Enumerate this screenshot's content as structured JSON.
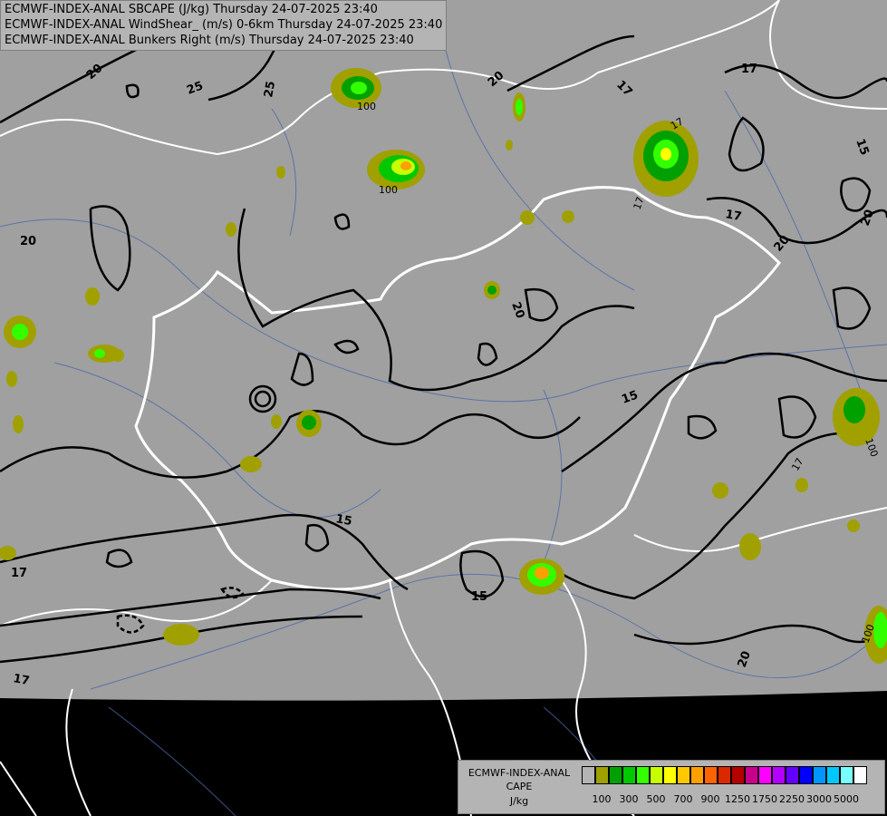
{
  "header": {
    "lines": [
      "ECMWF-INDEX-ANAL SBCAPE (J/kg) Thursday 24-07-2025 23:40",
      "ECMWF-INDEX-ANAL WindShear_ (m/s) 0-6km Thursday 24-07-2025 23:40",
      "ECMWF-INDEX-ANAL Bunkers Right (m/s) Thursday 24-07-2025 23:40"
    ]
  },
  "legend": {
    "title_lines": [
      "ECMWF-INDEX-ANAL",
      "CAPE",
      "J/kg"
    ],
    "colors": [
      "#b4b4b4",
      "#a0a000",
      "#00a000",
      "#00c800",
      "#32ff00",
      "#c8ff00",
      "#ffff00",
      "#ffc800",
      "#ffa000",
      "#ff6400",
      "#dc2800",
      "#b40000",
      "#c8008c",
      "#ff00ff",
      "#b400ff",
      "#6400ff",
      "#0000ff",
      "#0096ff",
      "#00c8ff",
      "#78ffff",
      "#ffffff"
    ],
    "tick_labels": [
      "100",
      "300",
      "500",
      "700",
      "900",
      "1250",
      "1750",
      "2250",
      "3000",
      "5000"
    ]
  },
  "contour_labels": [
    "20",
    "25",
    "25",
    "20",
    "17",
    "17",
    "15",
    "20",
    "17",
    "20",
    "20",
    "15",
    "15",
    "15",
    "17",
    "17",
    "20",
    "20",
    "100",
    "100",
    "100",
    "100",
    "17",
    "17",
    "17"
  ]
}
